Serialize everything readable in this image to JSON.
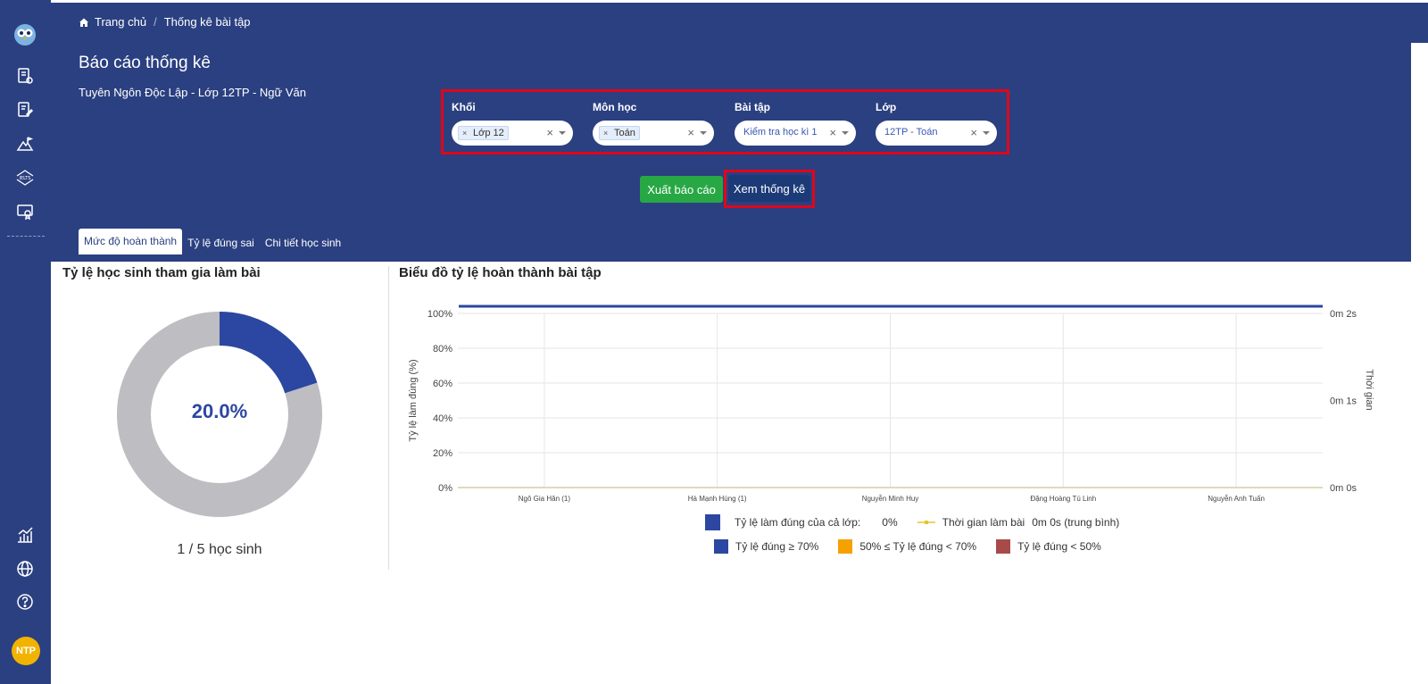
{
  "breadcrumb": {
    "home": "Trang chủ",
    "current": "Thống kê bài tập"
  },
  "page": {
    "title": "Báo cáo thống kê",
    "subtitle": "Tuyên Ngôn Độc Lập - Lớp 12TP - Ngữ Văn"
  },
  "filters": [
    {
      "label": "Khối",
      "value": "Lớp 12",
      "style": "tag"
    },
    {
      "label": "Môn học",
      "value": "Toán",
      "style": "tag"
    },
    {
      "label": "Bài tập",
      "value": "Kiểm tra học kì 1",
      "style": "plain"
    },
    {
      "label": "Lớp",
      "value": "12TP - Toán",
      "style": "plain"
    }
  ],
  "buttons": {
    "export": "Xuất báo cáo",
    "view": "Xem thống kê"
  },
  "tabs": [
    "Mức độ hoàn thành",
    "Tỷ lệ đúng sai",
    "Chi tiết học sinh"
  ],
  "participation": {
    "title": "Tỷ lệ học sinh tham gia làm bài",
    "percent_label": "20.0%",
    "fraction": 0.2,
    "caption": "1 / 5 học sinh"
  },
  "completion_chart_title": "Biểu đồ tỷ lệ hoàn thành bài tập",
  "chart_data": {
    "type": "bar",
    "categories": [
      "Ngô Gia Hân (1)",
      "Hà Mạnh Hùng (1)",
      "Nguyễn Minh Huy",
      "Đặng Hoàng Tú Linh",
      "Nguyễn Anh Tuấn"
    ],
    "values": [
      0,
      0,
      0,
      0,
      0
    ],
    "ylabel": "Tỷ lệ làm đúng (%)",
    "y2label": "Thời gian",
    "yticks": [
      "0%",
      "20%",
      "40%",
      "60%",
      "80%",
      "100%"
    ],
    "y2ticks": [
      "0m 0s",
      "0m 1s",
      "0m 2s"
    ],
    "ylim": [
      0,
      100
    ],
    "class_rate_line": 100,
    "legend": {
      "class_rate_label": "Tỷ lệ làm đúng của cả lớp:",
      "class_rate_value": "0%",
      "time_label": "Thời gian làm bài",
      "time_value": "0m 0s (trung bình)",
      "bands": [
        "Tỷ lệ đúng ≥ 70%",
        "50% ≤ Tỷ lệ đúng < 70%",
        "Tỷ lệ đúng < 50%"
      ]
    }
  },
  "colors": {
    "primary": "#2b4080",
    "accent_blue": "#2c47a1",
    "green": "#27a844",
    "orange": "#f5a201",
    "red": "#a94a4a",
    "highlight": "#e0061b"
  },
  "user": {
    "initials": "NTP"
  }
}
